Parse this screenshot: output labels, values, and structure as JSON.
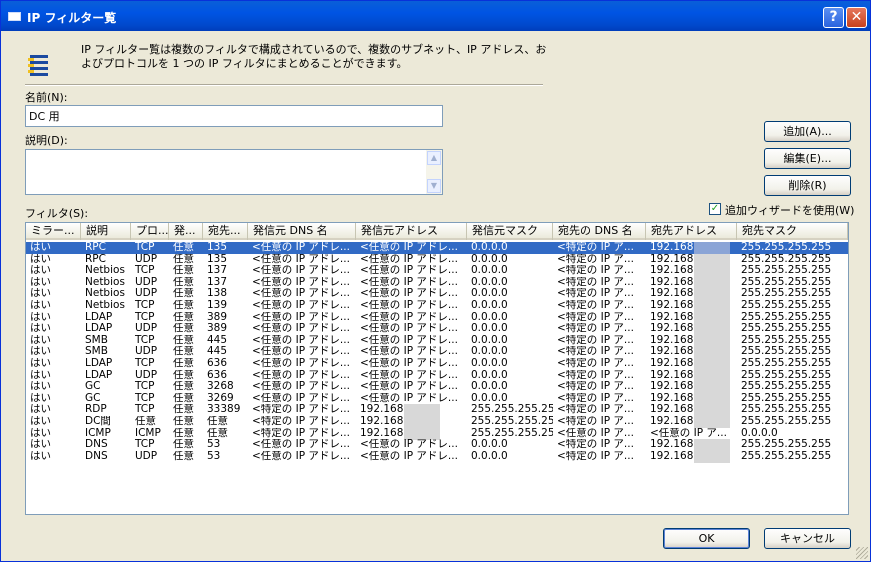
{
  "window": {
    "title": "IP フィルター覧"
  },
  "intro": {
    "icon": "filter-list-icon",
    "text": "IP フィルター覧は複数のフィルタで構成されているので、複数のサブネット、IP アドレス、およびプロトコルを 1 つの IP フィルタにまとめることができます。"
  },
  "name_field": {
    "label": "名前(N):",
    "value": "DC 用"
  },
  "description_field": {
    "label": "説明(D):",
    "value": ""
  },
  "buttons": {
    "add": "追加(A)...",
    "edit": "編集(E)...",
    "remove": "削除(R)",
    "ok": "OK",
    "cancel": "キャンセル"
  },
  "wizard_checkbox": {
    "label": "追加ウィザードを使用(W)",
    "checked": true
  },
  "filters": {
    "label": "フィルタ(S):",
    "columns": [
      "ミラー...",
      "説明",
      "プロ...",
      "発...",
      "宛先...",
      "発信元 DNS 名",
      "発信元アドレス",
      "発信元マスク",
      "宛先の DNS 名",
      "宛先アドレス",
      "宛先マスク"
    ],
    "rows": [
      [
        "はい",
        "RPC",
        "TCP",
        "任意",
        "135",
        "<任意の IP アドレ...",
        "<任意の IP アドレ...",
        "0.0.0.0",
        "<特定の IP ア...",
        "192.168.",
        "255.255.255.255"
      ],
      [
        "はい",
        "RPC",
        "UDP",
        "任意",
        "135",
        "<任意の IP アドレ...",
        "<任意の IP アドレ...",
        "0.0.0.0",
        "<特定の IP ア...",
        "192.168.",
        "255.255.255.255"
      ],
      [
        "はい",
        "Netbios",
        "TCP",
        "任意",
        "137",
        "<任意の IP アドレ...",
        "<任意の IP アドレ...",
        "0.0.0.0",
        "<特定の IP ア...",
        "192.168.",
        "255.255.255.255"
      ],
      [
        "はい",
        "Netbios",
        "UDP",
        "任意",
        "137",
        "<任意の IP アドレ...",
        "<任意の IP アドレ...",
        "0.0.0.0",
        "<特定の IP ア...",
        "192.168.",
        "255.255.255.255"
      ],
      [
        "はい",
        "Netbios",
        "UDP",
        "任意",
        "138",
        "<任意の IP アドレ...",
        "<任意の IP アドレ...",
        "0.0.0.0",
        "<特定の IP ア...",
        "192.168.",
        "255.255.255.255"
      ],
      [
        "はい",
        "Netbios",
        "TCP",
        "任意",
        "139",
        "<任意の IP アドレ...",
        "<任意の IP アドレ...",
        "0.0.0.0",
        "<特定の IP ア...",
        "192.168.",
        "255.255.255.255"
      ],
      [
        "はい",
        "LDAP",
        "TCP",
        "任意",
        "389",
        "<任意の IP アドレ...",
        "<任意の IP アドレ...",
        "0.0.0.0",
        "<特定の IP ア...",
        "192.168.",
        "255.255.255.255"
      ],
      [
        "はい",
        "LDAP",
        "UDP",
        "任意",
        "389",
        "<任意の IP アドレ...",
        "<任意の IP アドレ...",
        "0.0.0.0",
        "<特定の IP ア...",
        "192.168.",
        "255.255.255.255"
      ],
      [
        "はい",
        "SMB",
        "TCP",
        "任意",
        "445",
        "<任意の IP アドレ...",
        "<任意の IP アドレ...",
        "0.0.0.0",
        "<特定の IP ア...",
        "192.168.",
        "255.255.255.255"
      ],
      [
        "はい",
        "SMB",
        "UDP",
        "任意",
        "445",
        "<任意の IP アドレ...",
        "<任意の IP アドレ...",
        "0.0.0.0",
        "<特定の IP ア...",
        "192.168.",
        "255.255.255.255"
      ],
      [
        "はい",
        "LDAP",
        "TCP",
        "任意",
        "636",
        "<任意の IP アドレ...",
        "<任意の IP アドレ...",
        "0.0.0.0",
        "<特定の IP ア...",
        "192.168.",
        "255.255.255.255"
      ],
      [
        "はい",
        "LDAP",
        "UDP",
        "任意",
        "636",
        "<任意の IP アドレ...",
        "<任意の IP アドレ...",
        "0.0.0.0",
        "<特定の IP ア...",
        "192.168.",
        "255.255.255.255"
      ],
      [
        "はい",
        "GC",
        "TCP",
        "任意",
        "3268",
        "<任意の IP アドレ...",
        "<任意の IP アドレ...",
        "0.0.0.0",
        "<特定の IP ア...",
        "192.168.",
        "255.255.255.255"
      ],
      [
        "はい",
        "GC",
        "TCP",
        "任意",
        "3269",
        "<任意の IP アドレ...",
        "<任意の IP アドレ...",
        "0.0.0.0",
        "<特定の IP ア...",
        "192.168.",
        "255.255.255.255"
      ],
      [
        "はい",
        "RDP",
        "TCP",
        "任意",
        "33389",
        "<特定の IP アドレ...",
        "192.168.",
        "255.255.255.255",
        "<特定の IP ア...",
        "192.168.",
        "255.255.255.255"
      ],
      [
        "はい",
        "DC間",
        "任意",
        "任意",
        "任意",
        "<特定の IP アドレ...",
        "192.168.",
        "255.255.255.255",
        "<特定の IP ア...",
        "192.168.",
        "255.255.255.255"
      ],
      [
        "はい",
        "ICMP",
        "ICMP",
        "任意",
        "任意",
        "<特定の IP アドレ...",
        "192.168.",
        "255.255.255.255",
        "<任意の IP ア...",
        "<任意の IP ア...",
        "0.0.0.0"
      ],
      [
        "はい",
        "DNS",
        "TCP",
        "任意",
        "53",
        "<任意の IP アドレ...",
        "<任意の IP アドレ...",
        "0.0.0.0",
        "<特定の IP ア...",
        "192.168.",
        "255.255.255.255"
      ],
      [
        "はい",
        "DNS",
        "UDP",
        "任意",
        "53",
        "<任意の IP アドレ...",
        "<任意の IP アドレ...",
        "0.0.0.0",
        "<特定の IP ア...",
        "192.168.",
        "255.255.255.255"
      ]
    ],
    "selected_row": 0
  }
}
